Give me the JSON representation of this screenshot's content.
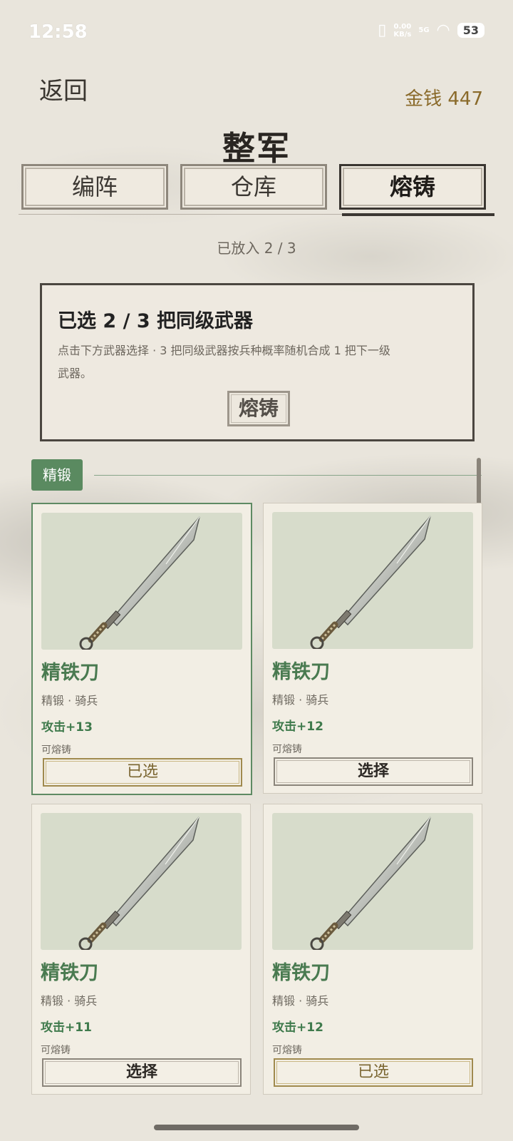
{
  "status_bar": {
    "time": "12:58",
    "net_speed": "0.00",
    "net_unit": "KB/s",
    "signal": "5G",
    "battery": "53"
  },
  "header": {
    "back_label": "返回",
    "money_label": "金钱 447",
    "title": "整军"
  },
  "tabs": [
    {
      "label": "编阵",
      "active": false
    },
    {
      "label": "仓库",
      "active": false
    },
    {
      "label": "熔铸",
      "active": true
    }
  ],
  "placed_text": "已放入 2 / 3",
  "panel": {
    "title": "已选 2 / 3 把同级武器",
    "description": "点击下方武器选择 · 3 把同级武器按兵种概率随机合成 1 把下一级武器。",
    "forge_label": "熔铸"
  },
  "group": {
    "label": "精锻"
  },
  "cards": [
    {
      "name": "精铁刀",
      "meta": "精锻 · 骑兵",
      "attack": "攻击+13",
      "note": "可熔铸",
      "button": "已选",
      "selected": true
    },
    {
      "name": "精铁刀",
      "meta": "精锻 · 骑兵",
      "attack": "攻击+12",
      "note": "可熔铸",
      "button": "选择",
      "selected": false
    },
    {
      "name": "精铁刀",
      "meta": "精锻 · 骑兵",
      "attack": "攻击+11",
      "note": "可熔铸",
      "button": "选择",
      "selected": false
    },
    {
      "name": "精铁刀",
      "meta": "精锻 · 骑兵",
      "attack": "攻击+12",
      "note": "可熔铸",
      "button": "已选",
      "selected": false
    }
  ],
  "colors": {
    "accent_green": "#5a8a60",
    "money_gold": "#8a6a2a",
    "card_image_bg": "#d7dccb"
  }
}
